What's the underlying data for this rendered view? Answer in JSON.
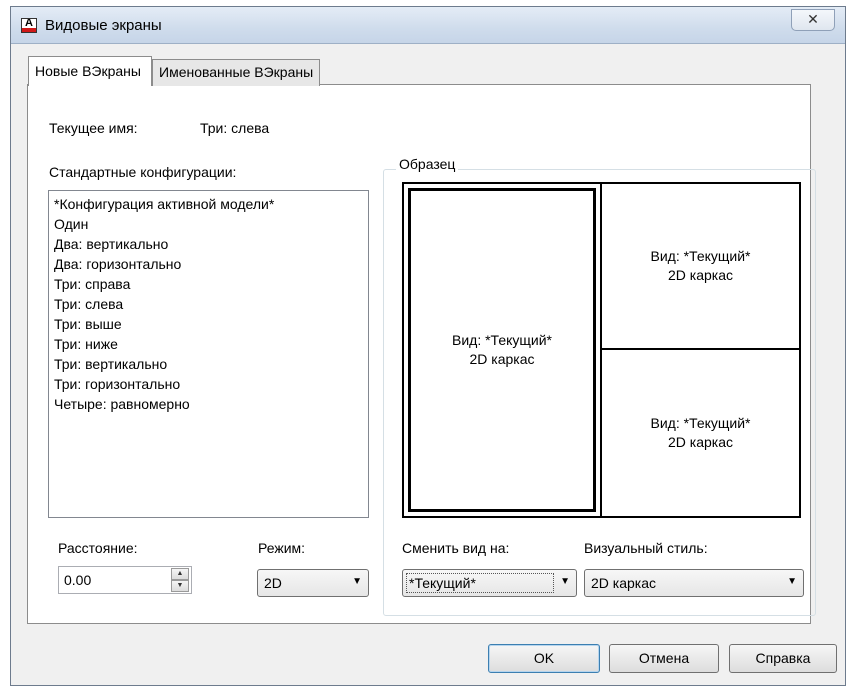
{
  "window": {
    "title": "Видовые экраны",
    "close_glyph": "✕",
    "icon_letter": "A"
  },
  "tabs": [
    "Новые ВЭкраны",
    "Именованные ВЭкраны"
  ],
  "current_name": {
    "label": "Текущее имя:",
    "value": "Три: слева"
  },
  "standard_configs": {
    "label": "Стандартные конфигурации:",
    "items": [
      "*Конфигурация активной модели*",
      "Один",
      "Два: вертикально",
      "Два: горизонтально",
      "Три: справа",
      "Три: слева",
      "Три: выше",
      "Три: ниже",
      "Три: вертикально",
      "Три: горизонтально",
      "Четыре: равномерно"
    ]
  },
  "preview": {
    "title": "Образец",
    "viewports": [
      {
        "line1": "Вид: *Текущий*",
        "line2": "2D каркас"
      },
      {
        "line1": "Вид: *Текущий*",
        "line2": "2D каркас"
      },
      {
        "line1": "Вид: *Текущий*",
        "line2": "2D каркас"
      }
    ]
  },
  "spacing": {
    "label": "Расстояние:",
    "value": "0.00"
  },
  "mode": {
    "label": "Режим:",
    "value": "2D"
  },
  "change_view": {
    "label": "Сменить вид на:",
    "value": "*Текущий*"
  },
  "visual_style": {
    "label": "Визуальный стиль:",
    "value": "2D каркас"
  },
  "buttons": {
    "ok": "OK",
    "cancel": "Отмена",
    "help": "Справка"
  }
}
